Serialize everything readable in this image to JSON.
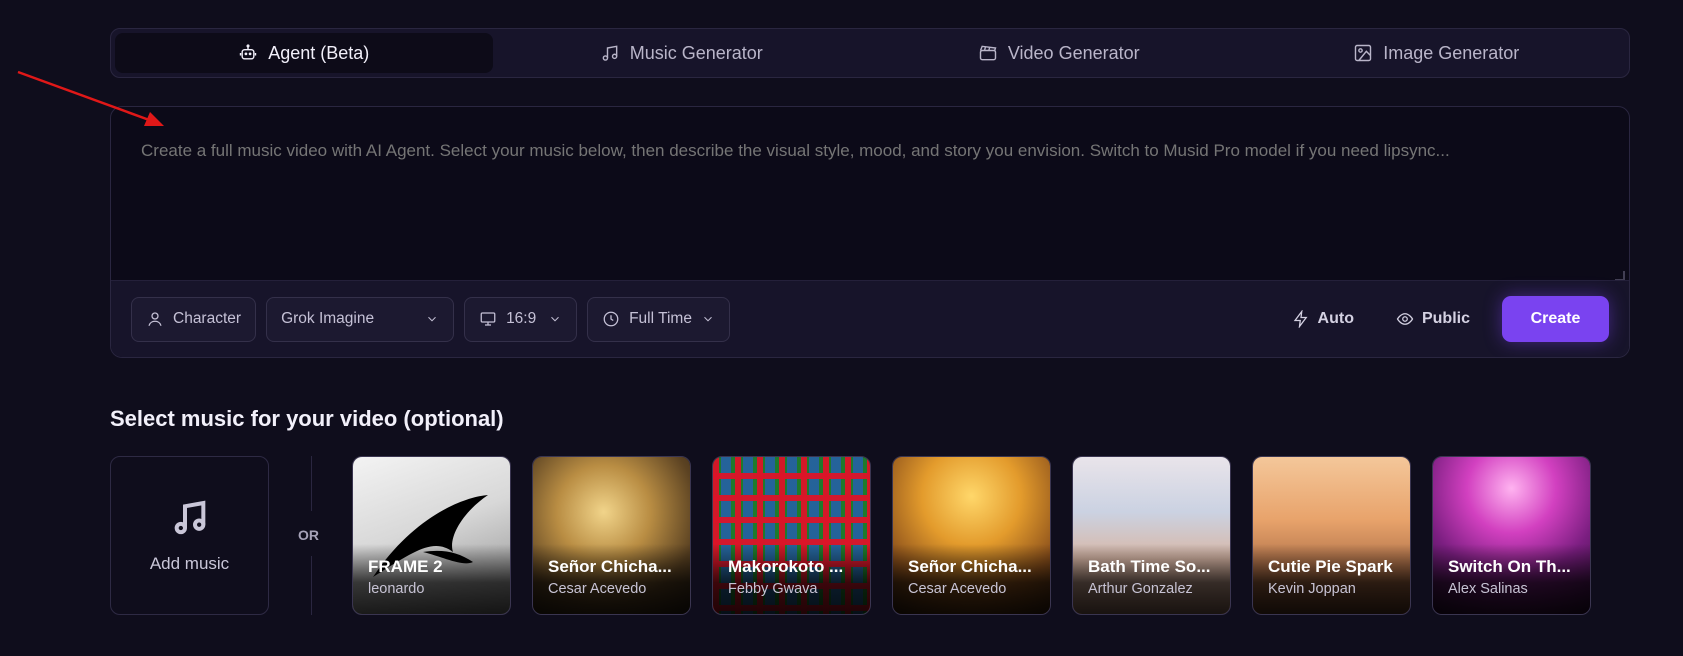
{
  "tabs": [
    {
      "label": "Agent (Beta)",
      "icon": "robot-icon",
      "active": true
    },
    {
      "label": "Music Generator",
      "icon": "music-note-icon",
      "active": false
    },
    {
      "label": "Video Generator",
      "icon": "clapperboard-icon",
      "active": false
    },
    {
      "label": "Image Generator",
      "icon": "image-icon",
      "active": false
    }
  ],
  "prompt": {
    "placeholder": "Create a full music video with AI Agent. Select your music below, then describe the visual style, mood, and story you envision. Switch to Musid Pro model if you need lipsync...",
    "value": ""
  },
  "toolbar": {
    "character_label": "Character",
    "model_value": "Grok Imagine",
    "ratio_value": "16:9",
    "duration_value": "Full Time",
    "auto_label": "Auto",
    "visibility_label": "Public",
    "create_label": "Create",
    "accent_color": "#7a43f0"
  },
  "music_section": {
    "title": "Select music for your video (optional)",
    "add_label": "Add music",
    "or_label": "OR",
    "tracks": [
      {
        "title": "FRAME 2",
        "artist": "leonardo"
      },
      {
        "title": "Señor Chicha...",
        "artist": "Cesar Acevedo"
      },
      {
        "title": "Makorokoto ...",
        "artist": "Febby Gwava"
      },
      {
        "title": "Señor Chicha...",
        "artist": "Cesar Acevedo"
      },
      {
        "title": "Bath Time So...",
        "artist": "Arthur Gonzalez"
      },
      {
        "title": "Cutie Pie Spark",
        "artist": "Kevin Joppan"
      },
      {
        "title": "Switch On Th...",
        "artist": "Alex Salinas"
      }
    ]
  }
}
